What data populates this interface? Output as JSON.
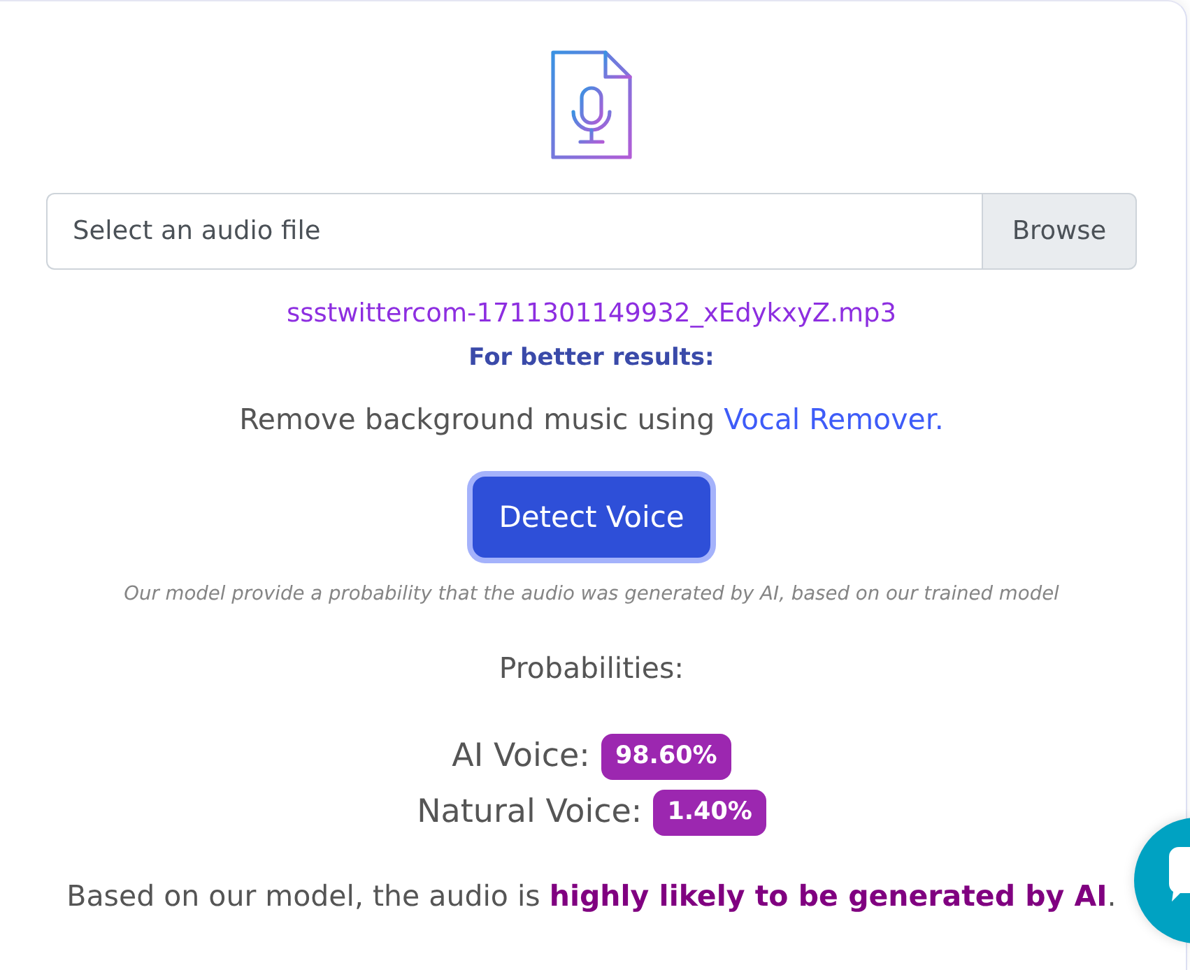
{
  "file_input": {
    "placeholder": "Select an audio file",
    "button": "Browse"
  },
  "selected_file": "ssstwittercom-1711301149932_xEdykxyZ.mp3",
  "tip": {
    "title": "For better results:",
    "text": "Remove background music using",
    "link": "Vocal Remover."
  },
  "detect_button": {
    "label": "Detect Voice",
    "focused": true
  },
  "disclaimer": "Our model provide a probability that the audio was generated by AI, based on our trained model",
  "probabilities": {
    "title": "Probabilities:",
    "items": [
      {
        "label": "AI Voice:",
        "value": "98.60%"
      },
      {
        "label": "Natural Voice:",
        "value": "1.40%"
      }
    ]
  },
  "verdict": "Based on our model, the audio is **highly likely to be generated by AI**."
}
